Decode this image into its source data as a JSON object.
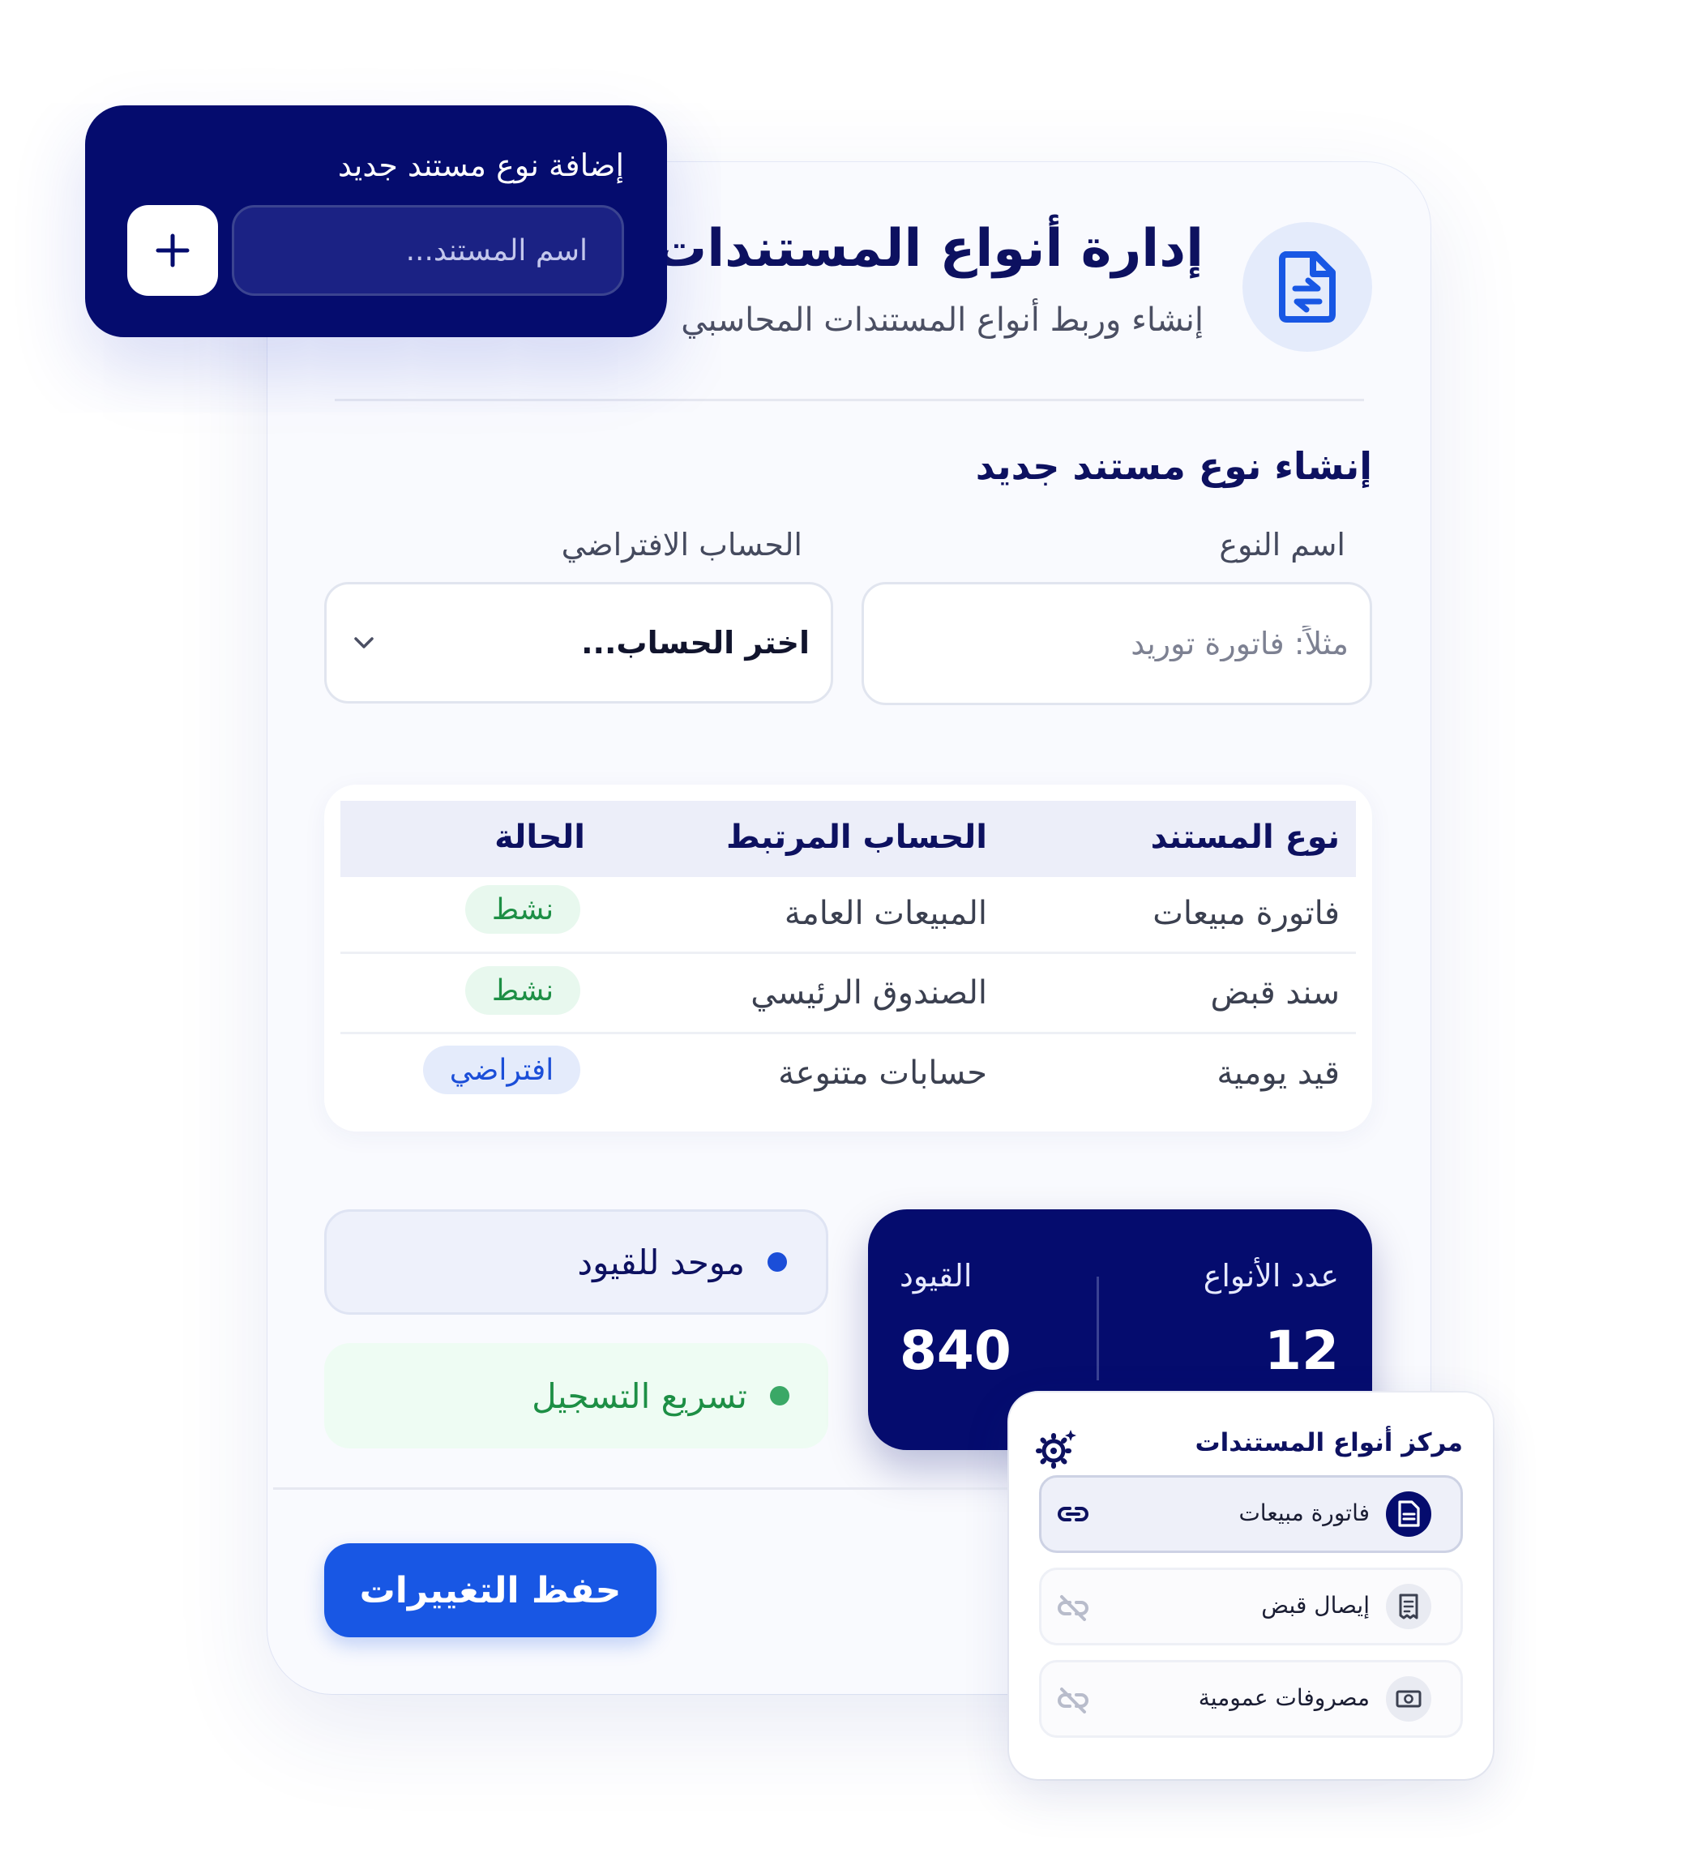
{
  "header": {
    "title": "إدارة أنواع المستندات",
    "subtitle": "إنشاء وربط أنواع المستندات المحاسبي"
  },
  "form": {
    "section_title": "إنشاء نوع مستند جديد",
    "name_label": "اسم النوع",
    "name_placeholder": "مثلاً: فاتورة توريد",
    "account_label": "الحساب الافتراضي",
    "account_value": "اختر الحساب..."
  },
  "table": {
    "headers": [
      "نوع المستند",
      "الحساب المرتبط",
      "الحالة"
    ],
    "rows": [
      {
        "type": "فاتورة مبيعات",
        "account": "المبيعات العامة",
        "status": "نشط",
        "status_color": "#1d8f45"
      },
      {
        "type": "سند قبض",
        "account": "الصندوق الرئيسي",
        "status": "نشط",
        "status_color": "#1d8f45"
      },
      {
        "type": "قيد يومية",
        "account": "حسابات متنوعة",
        "status": "افتراضي",
        "status_color": "#1b4ed8"
      }
    ]
  },
  "features": [
    {
      "label": "موحد للقيود",
      "dot_color": "#1b4ed8"
    },
    {
      "label": "تسريع التسجيل",
      "dot_color": "#3aa866"
    }
  ],
  "stats": {
    "types_label": "عدد الأنواع",
    "types_value": "12",
    "entries_label": "القيود",
    "entries_value": "840"
  },
  "save_label": "حفظ التغييرات",
  "add_card": {
    "title": "إضافة نوع مستند جديد",
    "placeholder": "اسم المستند...",
    "add_icon": "plus-icon"
  },
  "center": {
    "title": "مركز أنواع المستندات",
    "items": [
      {
        "label": "فاتورة مبيعات",
        "icon": "document-icon",
        "linked": true
      },
      {
        "label": "إيصال قبض",
        "icon": "receipt-icon",
        "linked": false
      },
      {
        "label": "مصروفات عمومية",
        "icon": "money-icon",
        "linked": false
      }
    ]
  },
  "colors": {
    "navy": "#050c6e",
    "primary": "#1857e4",
    "success": "#1d8f45"
  }
}
